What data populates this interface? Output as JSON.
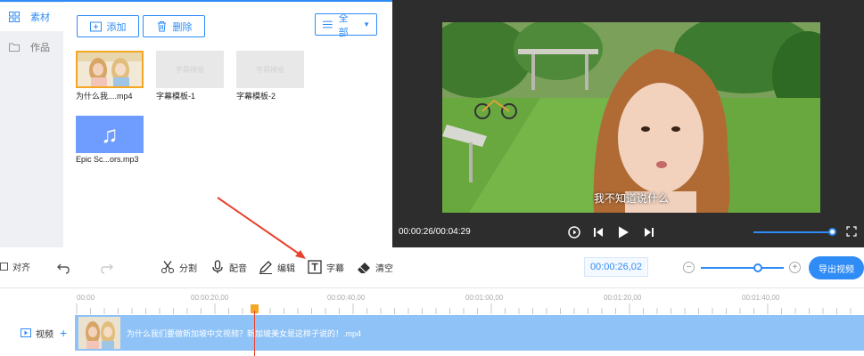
{
  "sidebar": {
    "items": [
      {
        "label": "素材",
        "icon": "grid-icon",
        "active": true
      },
      {
        "label": "作品",
        "icon": "folder-icon",
        "active": false
      }
    ]
  },
  "library": {
    "add_label": "添加",
    "delete_label": "删除",
    "filter_label": "全部",
    "items": [
      {
        "name": "为什么我....mp4",
        "kind": "video"
      },
      {
        "name": "字幕模板-1",
        "kind": "subtitle",
        "thumb_text": "字幕模板"
      },
      {
        "name": "字幕模板-2",
        "kind": "subtitle",
        "thumb_text": "字幕模板"
      },
      {
        "name": "Epic Sc...ors.mp3",
        "kind": "audio"
      }
    ]
  },
  "preview": {
    "subtitle": "我不知道说什么",
    "time": "00:00:26/00:04:29",
    "volume": 0.95
  },
  "toolbar": {
    "align_label": "对齐",
    "split_label": "分割",
    "dub_label": "配音",
    "edit_label": "编辑",
    "subtitle_label": "字幕",
    "clear_label": "清空",
    "current_time": "00:00:26,02",
    "zoom_level": 0.65,
    "export_label": "导出视频"
  },
  "timeline": {
    "ticks": [
      "00:00",
      "00:00:20,00",
      "00:00:40,00",
      "00:01:00,00",
      "00:01:20,00",
      "00:01:40,00"
    ],
    "track_label": "视频",
    "clip_name": "为什么我们要做新加坡中文视频？新加坡美女是这样子说的！.mp4"
  },
  "colors": {
    "accent": "#2f8cf6",
    "clip": "#8fc3f7",
    "playhead": "#f5a623",
    "annotation_arrow": "#e8412c"
  }
}
